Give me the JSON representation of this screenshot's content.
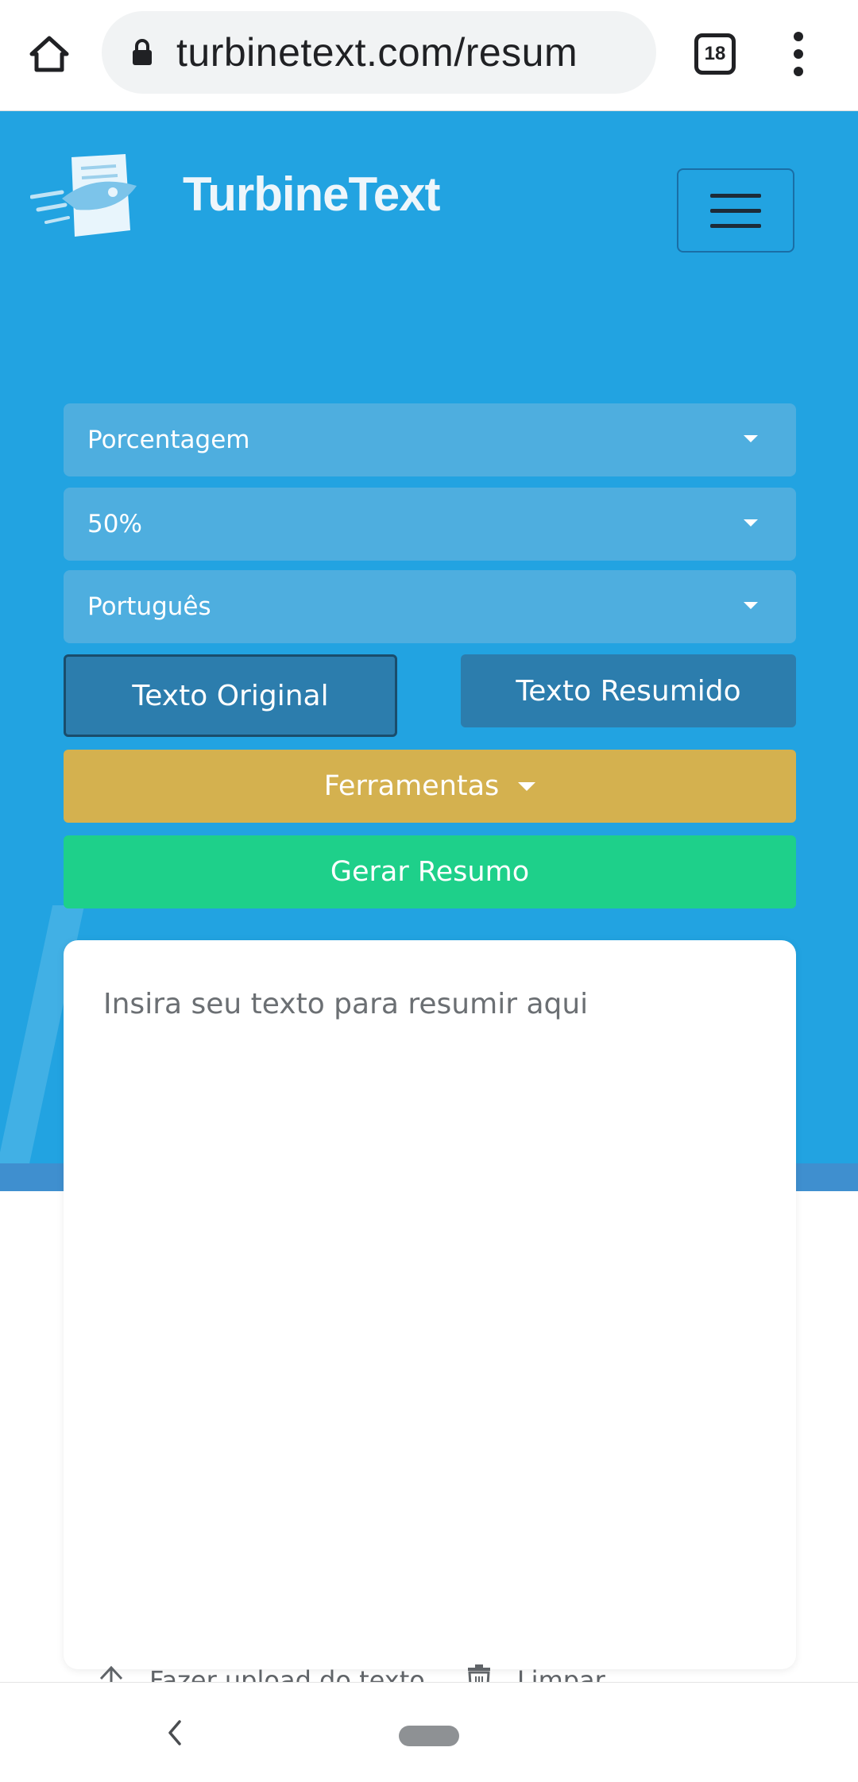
{
  "browser": {
    "url": "turbinetext.com/resum",
    "tab_count": "18",
    "icons": {
      "home": "home-icon",
      "lock": "lock-icon",
      "tabs": "tab-switcher-icon",
      "menu": "more-vert-icon"
    }
  },
  "header": {
    "brand": "TurbineText",
    "logo_icon": "document-rocket-logo",
    "menu_icon": "hamburger-menu-icon"
  },
  "form": {
    "mode_select": "Porcentagem",
    "percent_select": "50%",
    "language_select": "Português",
    "tabs": [
      {
        "label": "Texto Original",
        "active": true
      },
      {
        "label": "Texto Resumido",
        "active": false
      }
    ],
    "tools_label": "Ferramentas",
    "generate_label": "Gerar Resumo",
    "input_placeholder": "Insira seu texto para resumir aqui",
    "upload_label": "Fazer upload do texto",
    "clear_label": "Limpar"
  },
  "colors": {
    "hero_bg": "#22a3e1",
    "select_bg": "#4eaedf",
    "tab_bg": "#2c7dad",
    "tools_bg": "#d4b14f",
    "generate_bg": "#1ed08a"
  }
}
